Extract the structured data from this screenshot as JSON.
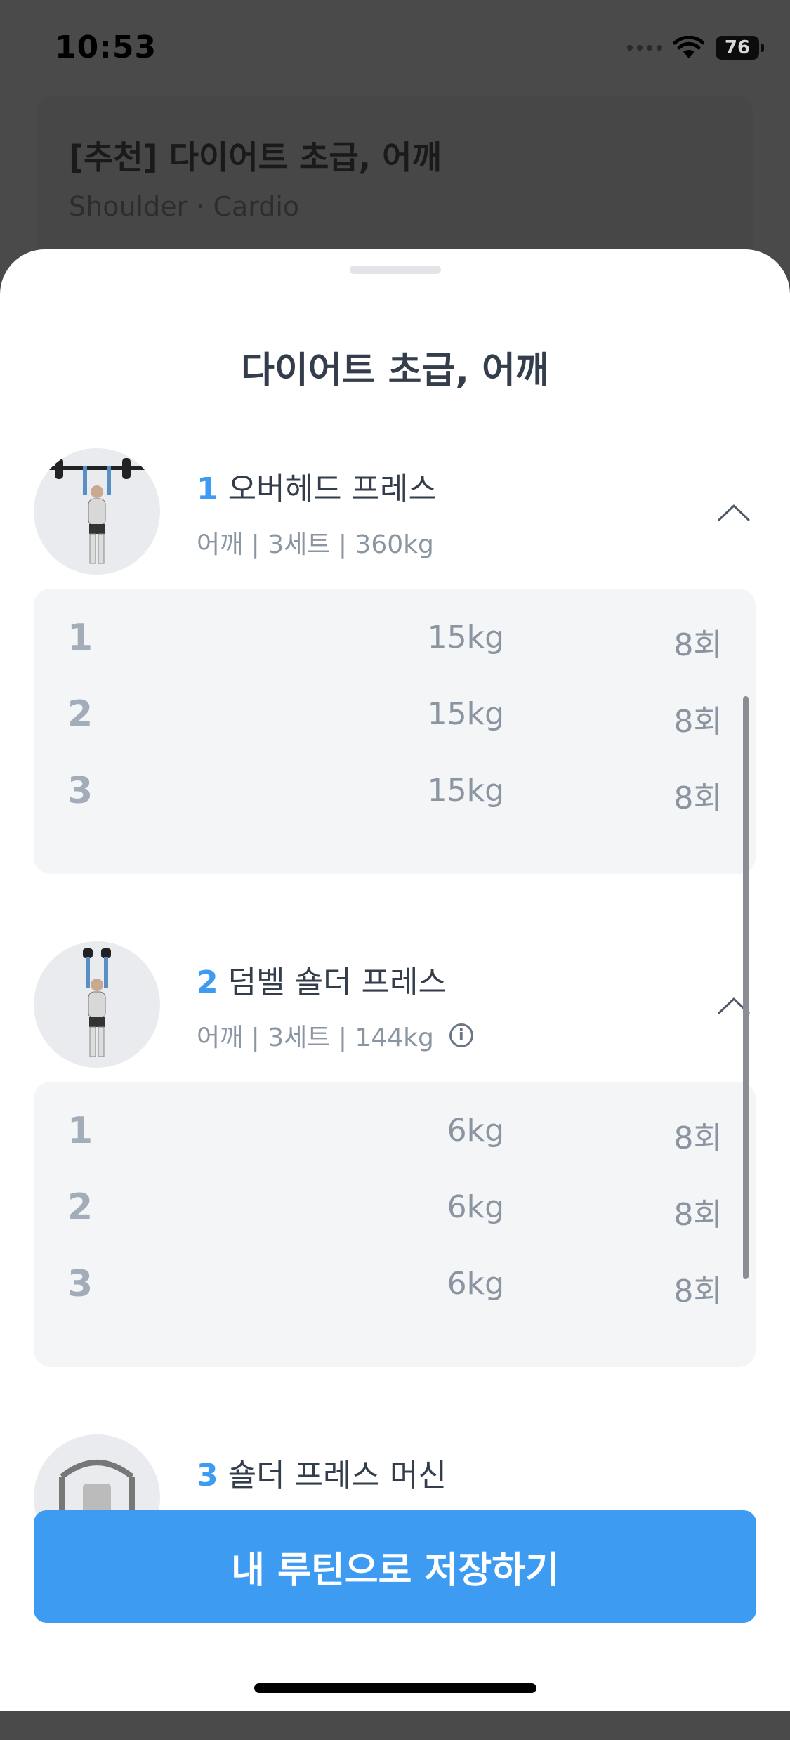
{
  "status_bar": {
    "time": "10:53",
    "battery": "76"
  },
  "background_card": {
    "title": "[추천] 다이어트 초급, 어깨",
    "subtitle": "Shoulder · Cardio"
  },
  "sheet": {
    "title": "다이어트 초급, 어깨"
  },
  "exercises": [
    {
      "number": "1",
      "name": "오버헤드 프레스",
      "meta": "어깨 | 3세트 | 360kg",
      "sets": [
        {
          "set": "1",
          "weight": "15kg",
          "reps": "8회"
        },
        {
          "set": "2",
          "weight": "15kg",
          "reps": "8회"
        },
        {
          "set": "3",
          "weight": "15kg",
          "reps": "8회"
        }
      ]
    },
    {
      "number": "2",
      "name": "덤벨 숄더 프레스",
      "meta": "어깨 | 3세트 | 144kg",
      "info_icon": "ⓘ",
      "sets": [
        {
          "set": "1",
          "weight": "6kg",
          "reps": "8회"
        },
        {
          "set": "2",
          "weight": "6kg",
          "reps": "8회"
        },
        {
          "set": "3",
          "weight": "6kg",
          "reps": "8회"
        }
      ]
    },
    {
      "number": "3",
      "name": "숄더 프레스 머신"
    }
  ],
  "cta": {
    "label": "내 루틴으로 저장하기"
  },
  "colors": {
    "accent": "#3d9bf2",
    "sheet_bg": "#ffffff",
    "set_box_bg": "#f3f5f7",
    "overlay": "#4a4a4a"
  }
}
